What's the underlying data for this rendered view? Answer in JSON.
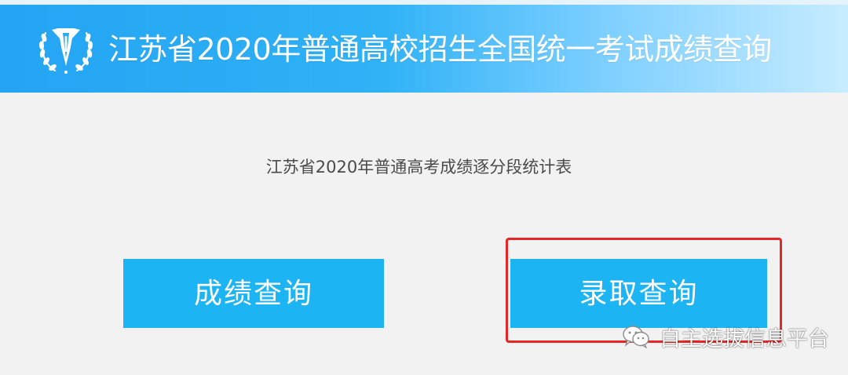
{
  "header": {
    "title": "江苏省2020年普通高校招生全国统一考试成绩查询",
    "logo_icon": "exam-authority-emblem-icon"
  },
  "main": {
    "subtitle": "江苏省2020年普通高考成绩逐分段统计表",
    "buttons": [
      {
        "label": "成绩查询"
      },
      {
        "label": "录取查询"
      }
    ]
  },
  "watermark": {
    "text": "自主选拔信息平台",
    "icon": "wechat-icon"
  },
  "colors": {
    "header_blue": "#24a4f3",
    "button_blue": "#1cb4f2",
    "highlight_red": "#e82626",
    "background": "#f2f2f2"
  }
}
